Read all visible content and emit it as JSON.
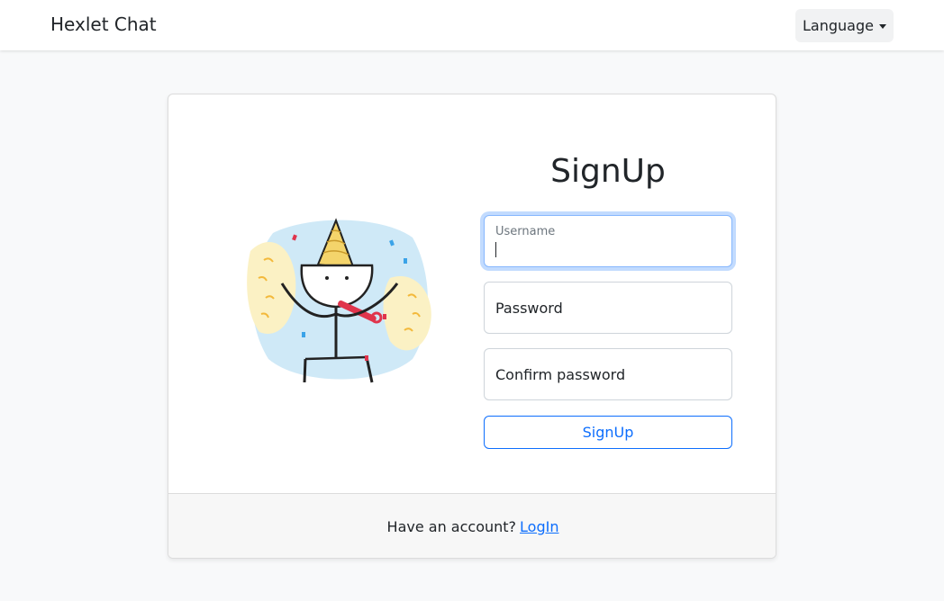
{
  "navbar": {
    "brand": "Hexlet Chat",
    "language_label": "Language"
  },
  "form": {
    "title": "SignUp",
    "username_label": "Username",
    "password_label": "Password",
    "confirm_label": "Confirm password",
    "submit_label": "SignUp"
  },
  "footer": {
    "text": "Have an account?",
    "link": "LogIn"
  },
  "colors": {
    "primary": "#0d6efd",
    "background": "#f8f9fa"
  }
}
